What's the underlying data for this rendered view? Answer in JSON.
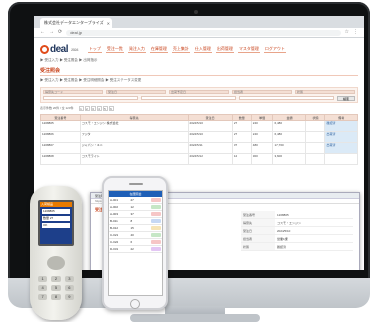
{
  "browser": {
    "tab_title": "株式会社データエンタープライズ",
    "url": "deal.jp"
  },
  "app": {
    "logo_text": "deal",
    "logo_sub": "2024",
    "nav": [
      "トップ",
      "受注一覧",
      "発注入力",
      "在庫管理",
      "売上集計",
      "仕入管理",
      "出荷管理",
      "マスタ管理",
      "ログアウト"
    ],
    "breadcrumb": "▶ 受注入力  ▶ 受注照会  ▶ 出荷指示",
    "section_title": "受注照会",
    "subnav": "▶ 受注入力 ▶ 受注照会 ▶ 受注明細照会 ▶ 受注ステータス変更",
    "filter_labels": [
      "得意先コード",
      "受注日",
      "出荷予定日",
      "担当者",
      "状態"
    ],
    "search_button": "検索",
    "pager_info": "表示件数 20件 / 全 120件"
  },
  "table": {
    "headers": [
      "受注番号",
      "得意先",
      "受注日",
      "数量",
      "単価",
      "金額",
      "状態",
      "備考"
    ],
    "rows": [
      [
        "1208805",
        "コスモ・エンジン 株式会社",
        "2024/5/10",
        "27",
        "240",
        "6,480",
        "",
        "確認済"
      ],
      [
        "1208806",
        "フジタ",
        "2024/5/10",
        "27",
        "240",
        "6,480",
        "",
        "出荷済"
      ],
      [
        "1208807",
        "ジャパン・ユニ",
        "2024/5/11",
        "37",
        "480",
        "17,760",
        "",
        "出荷済"
      ],
      [
        "1208808",
        "コスモライト",
        "2024/5/12",
        "12",
        "300",
        "3,600",
        "",
        ""
      ]
    ]
  },
  "popup": {
    "title": "受注明細 - 詳細",
    "address": "https://deal.jp/order/detail",
    "section": "受注明細",
    "fields": [
      {
        "k": "受注番号",
        "v": "1208805"
      },
      {
        "k": "得意先",
        "v": "コスモ・エンジン"
      },
      {
        "k": "受注日",
        "v": "2024/5/10"
      },
      {
        "k": "担当者",
        "v": "営業1課"
      },
      {
        "k": "状態",
        "v": "確認済"
      }
    ]
  },
  "scanner": {
    "header": "入荷検品",
    "lines": [
      "1208805",
      "数量 27",
      "OK"
    ],
    "keys": [
      "1",
      "2",
      "3",
      "4",
      "5",
      "6",
      "7",
      "8",
      "9"
    ]
  },
  "phone": {
    "header": "在庫照会",
    "rows": [
      {
        "name": "A-001",
        "qty": "27",
        "color": "#f6c6c6"
      },
      {
        "name": "A-002",
        "qty": "12",
        "color": "#c6e7c6"
      },
      {
        "name": "A-003",
        "qty": "37",
        "color": "#f6c6c6"
      },
      {
        "name": "B-011",
        "qty": "8",
        "color": "#c6d8f4"
      },
      {
        "name": "B-012",
        "qty": "15",
        "color": "#f6e4b6"
      },
      {
        "name": "C-021",
        "qty": "40",
        "color": "#c6e7c6"
      },
      {
        "name": "C-022",
        "qty": "6",
        "color": "#f6c6c6"
      },
      {
        "name": "D-031",
        "qty": "22",
        "color": "#e3c6f4"
      }
    ]
  }
}
